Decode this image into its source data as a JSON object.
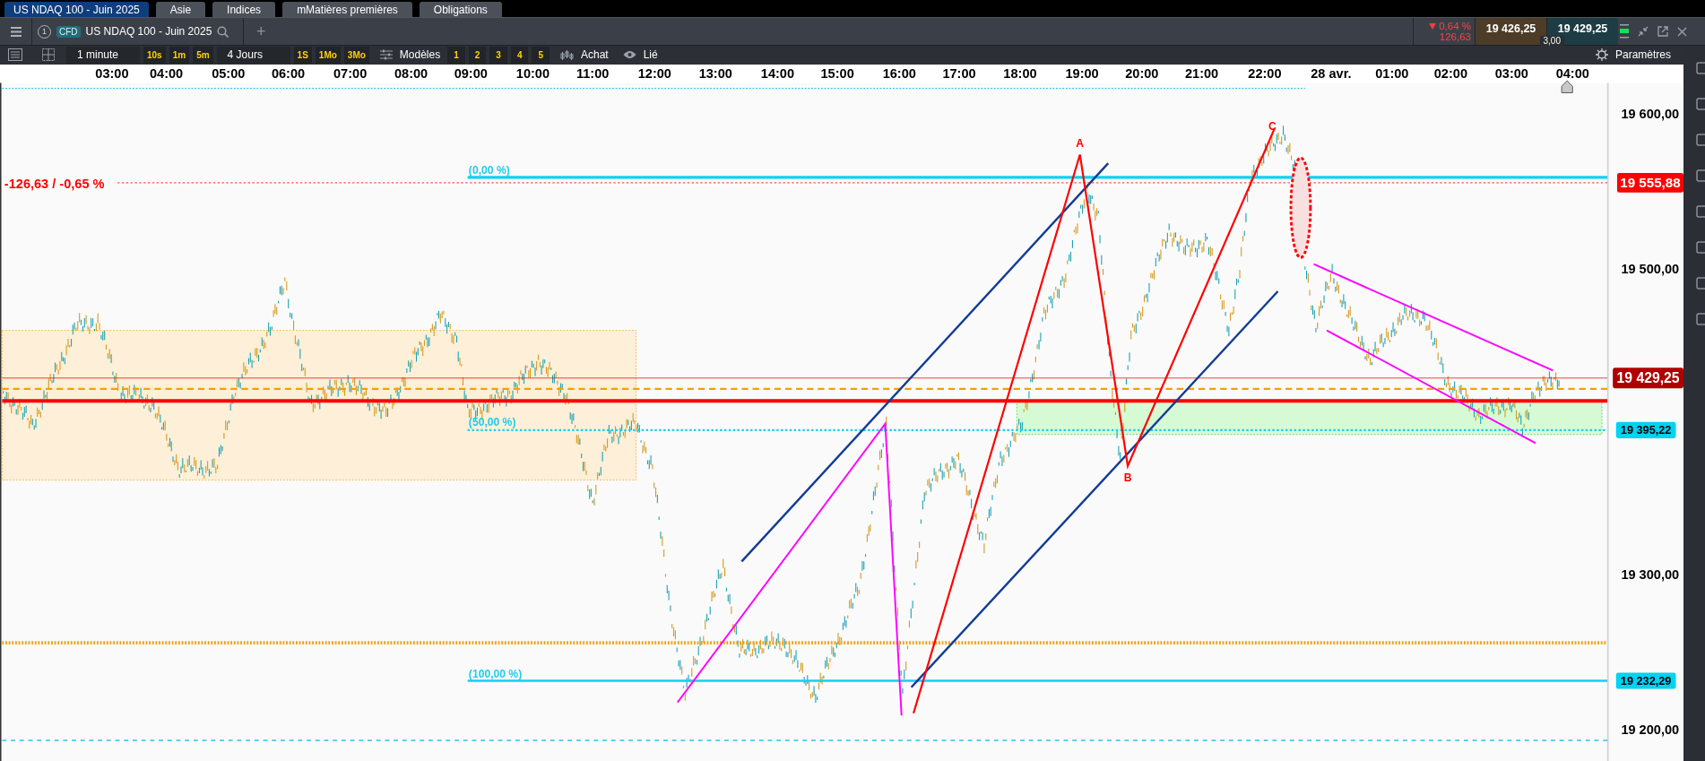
{
  "top_tabs": [
    {
      "label": "US NDAQ 100 - Juin 2025",
      "selected": true
    },
    {
      "label": "Asie",
      "selected": false
    },
    {
      "label": "Indices",
      "selected": false
    },
    {
      "label": "mMatières premières",
      "selected": false
    },
    {
      "label": "Obligations",
      "selected": false
    }
  ],
  "instrument": {
    "index": "1",
    "tag": "CFD",
    "name": "US NDAQ 100 - Juin 2025",
    "add": "+"
  },
  "quote": {
    "change_pct": "0,64 %",
    "change": "126,63",
    "bid": "19 426,25",
    "ask": "19 429,25",
    "spread": "3,00"
  },
  "toolbar": {
    "interval": "1 minute",
    "interval_buttons": [
      "10s",
      "1m",
      "5m"
    ],
    "range": "4 Jours",
    "range_buttons": [
      "1S",
      "1Mo",
      "3Mo"
    ],
    "templates": "Modèles",
    "slots": [
      "1",
      "2",
      "3",
      "4",
      "5"
    ],
    "chart_type": "Achat",
    "link": "Lié",
    "settings": "Paramètres"
  },
  "chart": {
    "time_labels": [
      "03:00",
      "04:00",
      "05:00",
      "06:00",
      "07:00",
      "08:00",
      "09:00",
      "10:00",
      "11:00",
      "12:00",
      "13:00",
      "14:00",
      "15:00",
      "16:00",
      "17:00",
      "18:00",
      "19:00",
      "20:00",
      "21:00",
      "22:00",
      "28 avr.",
      "01:00",
      "02:00",
      "03:00",
      "04:00"
    ],
    "price_labels": [
      "19 600,00",
      "19 500,00",
      "19 300,00",
      "19 200,00"
    ],
    "price_tags": [
      {
        "text": "19 555,88",
        "kind": "alert"
      },
      {
        "text": "19 429,25",
        "kind": "last"
      },
      {
        "text": "19 395,22",
        "kind": "level"
      },
      {
        "text": "19 232,29",
        "kind": "level"
      }
    ],
    "alert_label": "-126,63 / -0,65 %",
    "fib_labels": [
      "(0,00 %)",
      "(50,00 %)",
      "(100,00 %)"
    ],
    "wave_labels": [
      "A",
      "B",
      "C"
    ]
  }
}
